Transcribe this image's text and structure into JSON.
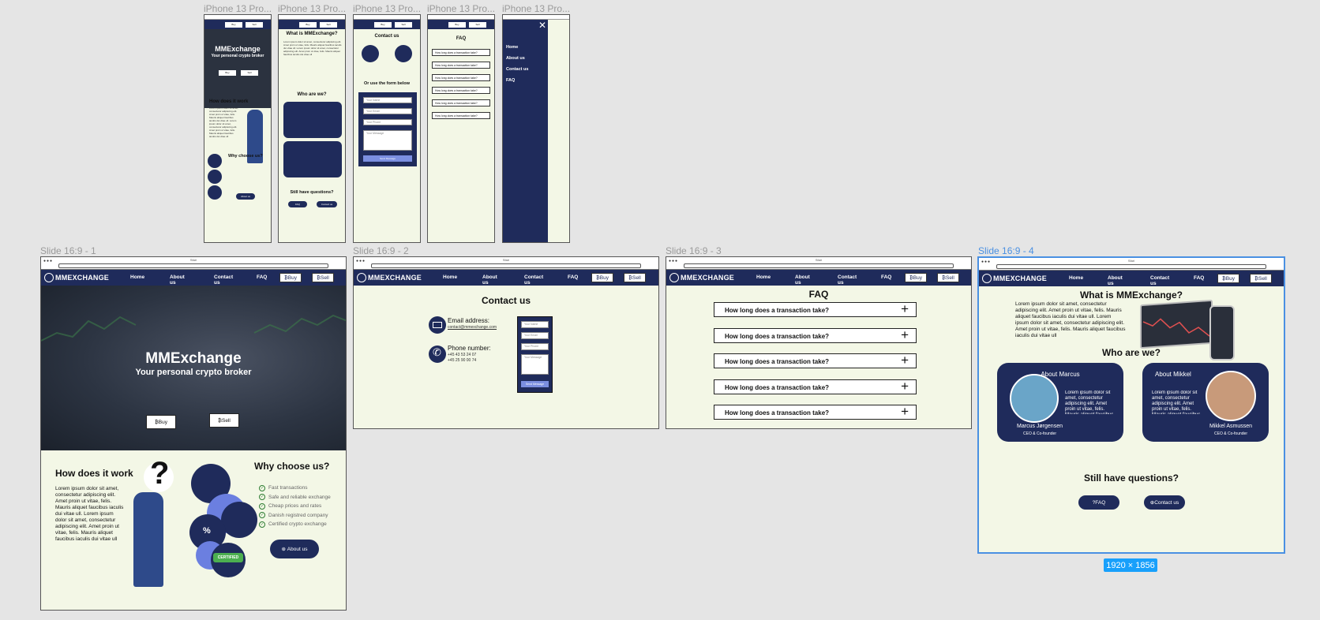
{
  "canvas": {
    "bg": "#e5e5e5",
    "accent": "#1f2b5b",
    "page_bg": "#f3f7e6",
    "selection": "#4a90e2"
  },
  "phone_frames": [
    {
      "label": "iPhone 13 Pro..."
    },
    {
      "label": "iPhone 13 Pro..."
    },
    {
      "label": "iPhone 13 Pro..."
    },
    {
      "label": "iPhone 13 Pro..."
    },
    {
      "label": "iPhone 13 Pro..."
    }
  ],
  "slide_frames": [
    {
      "label": "Slide 16:9 - 1"
    },
    {
      "label": "Slide 16:9 - 2"
    },
    {
      "label": "Slide 16:9 - 3"
    },
    {
      "label": "Slide 16:9 - 4"
    }
  ],
  "browser": {
    "title": "Sfari",
    "url": "http://mmexchange"
  },
  "nav": {
    "logo": "MMEXCHANGE",
    "links": [
      "Home",
      "About us",
      "Contact us",
      "FAQ"
    ],
    "buy": "Buy",
    "sell": "Sell"
  },
  "home": {
    "hero_title": "MMExchange",
    "hero_subtitle": "Your personal crypto broker",
    "buy": "Buy",
    "sell": "Sell",
    "how_title": "How does it work",
    "how_text": "Lorem ipsum dolor sit amet, consectetur adipiscing elit. Amet proin ut vitae, felis. Mauris aliquet faucibus iaculis dui vitae ull. Lorem ipsum dolor sit amet, consectetur adipiscing elit. Amet proin ut vitae, felis. Mauris aliquet faucibus iaculis dui vitae ull",
    "why_title": "Why choose us?",
    "reasons": [
      "Fast transactions",
      "Safe and reliable exchange",
      "Cheap prices and rates",
      "Danish registred company",
      "Certified crypto exchange"
    ],
    "about_btn": "About us",
    "certified": "CERTIFIED"
  },
  "contact": {
    "title": "Contact us",
    "email_label": "Email address:",
    "email": "contact@mmexchange.com",
    "phone_label": "Phone number:",
    "phone1": "+45 43 53 24 07",
    "phone2": "+45 25 90 00 74",
    "form_placeholders": [
      "Your Name",
      "Your Email",
      "Your Phone",
      "Your Message"
    ],
    "submit": "Send Message",
    "or_form": "Or use the form below"
  },
  "faq": {
    "title": "FAQ",
    "question": "How long does a transaction take?",
    "count": 5
  },
  "about": {
    "what_title": "What is MMExchange?",
    "what_text": "Lorem ipsum dolor sit amet, consectetur adipiscing elit. Amet proin ut vitae, felis. Mauris aliquet faucibus iaculis dui vitae ull. Lorem ipsum dolor sit amet, consectetur adipiscing elit. Amet proin ut vitae, felis. Mauris aliquet faucibus iaculis dui vitae ull",
    "who_title": "Who are we?",
    "marcus_title": "About Marcus",
    "marcus_text": "Lorem ipsum dolor sit amet, consectetur adipiscing elit. Amet proin ut vitae, felis. Mauris aliquet faucibus iaculis dui vitae ull",
    "marcus_name": "Marcus Jørgensen",
    "marcus_role": "CEO & Co-founder",
    "mikkel_title": "About Mikkel",
    "mikkel_text": "Lorem ipsum dolor sit amet, consectetur adipiscing elit. Amet proin ut vitae, felis. Mauris aliquet faucibus iaculis dui vitae ull",
    "mikkel_name": "Mikkel Asmussen",
    "mikkel_role": "CEO & Co-founder",
    "questions_title": "Still have questions?",
    "faq_btn": "FAQ",
    "contact_btn": "Contact us"
  },
  "menu": {
    "items": [
      "Home",
      "About us",
      "Contact us",
      "FAQ"
    ]
  },
  "size_badge": "1920 × 1856"
}
